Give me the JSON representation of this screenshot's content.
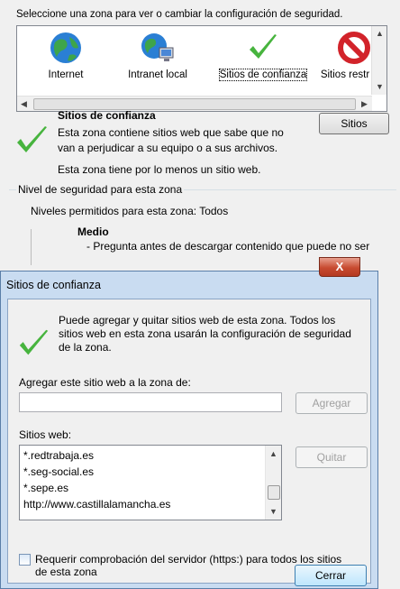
{
  "bg": {
    "prompt": "Seleccione una zona para ver o cambiar la configuración de seguridad.",
    "zones": [
      {
        "label": "Internet",
        "icon": "globe-icon"
      },
      {
        "label": "Intranet local",
        "icon": "network-globe-icon"
      },
      {
        "label": "Sitios de confianza",
        "icon": "checkmark-icon"
      },
      {
        "label": "Sitios restr",
        "icon": "restricted-icon"
      }
    ],
    "zone_title": "Sitios de confianza",
    "zone_desc_1": "Esta zona contiene sitios web que sabe que no",
    "zone_desc_2": "van a perjudicar a su equipo o a sus archivos.",
    "zone_count": "Esta zona tiene por lo menos un sitio web.",
    "sites_button": "Sitios",
    "level_group": "Nivel de seguridad para esta zona",
    "allowed_levels": "Niveles permitidos para esta zona: Todos",
    "level_name": "Medio",
    "level_bullet": "- Pregunta antes de descargar contenido que puede no ser"
  },
  "dialog": {
    "title": "Sitios de confianza",
    "close_label": "X",
    "info_1": "Puede agregar y quitar sitios web de esta zona. Todos los",
    "info_2": "sitios web en esta zona usarán la configuración de seguridad",
    "info_3": "de la zona.",
    "add_label": "Agregar este sitio web a la zona de:",
    "add_value": "",
    "add_button": "Agregar",
    "sites_label": "Sitios web:",
    "sites": [
      "*.redtrabaja.es",
      "*.seg-social.es",
      "*.sepe.es",
      "http://www.castillalamancha.es"
    ],
    "remove_button": "Quitar",
    "https_label_1": "Requerir comprobación del servidor (https:) para todos los sitios",
    "https_label_2": "de esta zona",
    "https_checked": false,
    "close_button": "Cerrar"
  }
}
